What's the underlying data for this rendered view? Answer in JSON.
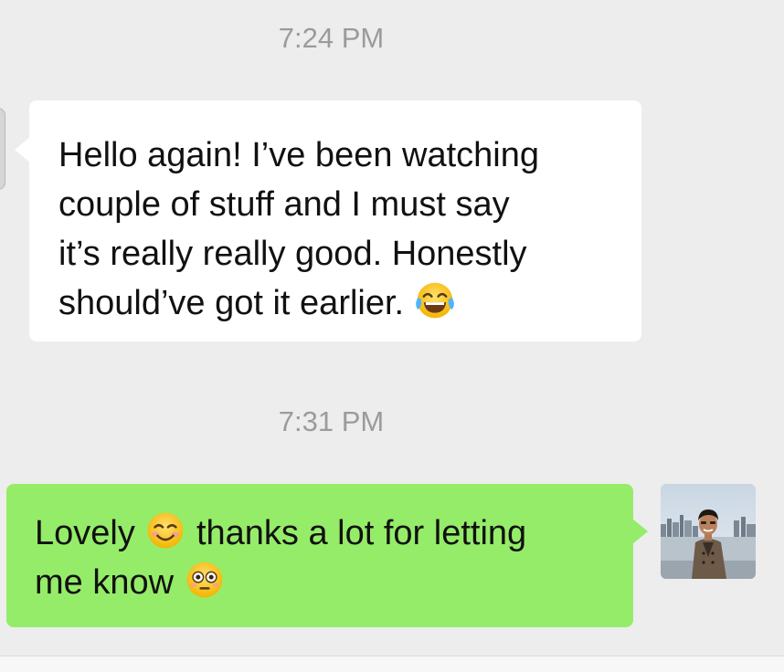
{
  "messages": [
    {
      "time": "7:24 PM",
      "direction": "incoming",
      "lines": [
        "Hello again! I’ve been watching",
        "couple of stuff and I must say",
        "it’s really really good. Honestly",
        "should’ve got it earlier."
      ],
      "trailing_emoji": "face-with-tears-of-joy-icon"
    },
    {
      "time": "7:31 PM",
      "direction": "outgoing",
      "line1_before_emoji": "Lovely",
      "line1_emoji": "smiling-face-icon",
      "line1_after_emoji": "thanks a lot for letting",
      "line2_text": "me know",
      "line2_emoji": "flushed-face-icon"
    }
  ],
  "colors": {
    "background": "#ededed",
    "incoming_bubble": "#ffffff",
    "outgoing_bubble": "#95ec69",
    "timestamp_text": "#9b9b9b"
  }
}
